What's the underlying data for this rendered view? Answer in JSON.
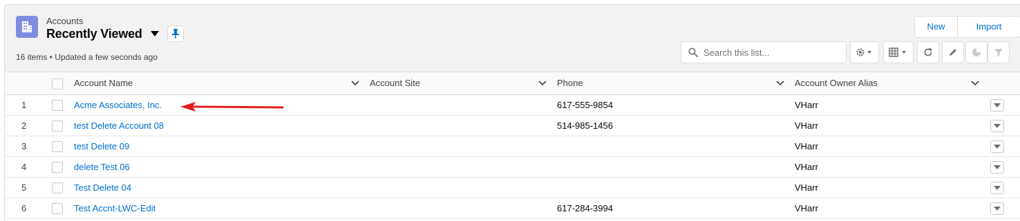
{
  "header": {
    "object_name": "Accounts",
    "view_title": "Recently Viewed",
    "meta": "16 items • Updated a few seconds ago"
  },
  "actions": {
    "new_label": "New",
    "import_label": "Import"
  },
  "search": {
    "placeholder": "Search this list..."
  },
  "toolbar": {
    "icons": [
      "gear-icon",
      "table-view-icon",
      "refresh-icon",
      "edit-icon",
      "chart-icon",
      "filter-icon"
    ]
  },
  "table": {
    "columns": [
      "Account Name",
      "Account Site",
      "Phone",
      "Account Owner Alias"
    ],
    "rows": [
      {
        "num": "1",
        "name": "Acme Associates, Inc.",
        "site": "",
        "phone": "617-555-9854",
        "owner": "VHarr"
      },
      {
        "num": "2",
        "name": "test Delete Account 08",
        "site": "",
        "phone": "514-985-1456",
        "owner": "VHarr"
      },
      {
        "num": "3",
        "name": "test Delete 09",
        "site": "",
        "phone": "",
        "owner": "VHarr"
      },
      {
        "num": "4",
        "name": "delete Test 06",
        "site": "",
        "phone": "",
        "owner": "VHarr"
      },
      {
        "num": "5",
        "name": "Test Delete 04",
        "site": "",
        "phone": "",
        "owner": "VHarr"
      },
      {
        "num": "6",
        "name": "Test Accnt-LWC-Edit",
        "site": "",
        "phone": "617-284-3994",
        "owner": "VHarr"
      }
    ]
  },
  "colors": {
    "brand_icon": "#7f8de1",
    "link": "#006dcc",
    "annotation_arrow": "#e0201b"
  }
}
